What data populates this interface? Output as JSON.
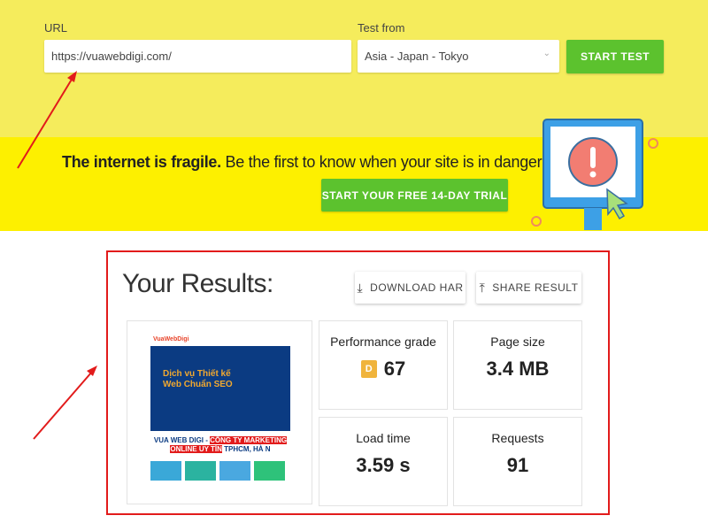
{
  "form": {
    "url_label": "URL",
    "url_value": "https://vuawebdigi.com/",
    "test_from_label": "Test from",
    "test_from_value": "Asia - Japan - Tokyo",
    "start_button": "START TEST"
  },
  "banner": {
    "bold": "The internet is fragile.",
    "text": " Be the first to know when your site is in danger.",
    "trial_button": "START YOUR FREE 14-DAY TRIAL"
  },
  "results": {
    "title": "Your Results:",
    "download_har": "DOWNLOAD HAR",
    "share_result": "SHARE RESULT",
    "performance": {
      "label": "Performance grade",
      "grade": "D",
      "value": "67"
    },
    "page_size": {
      "label": "Page size",
      "value": "3.4 MB"
    },
    "load_time": {
      "label": "Load time",
      "value": "3.59 s"
    },
    "requests": {
      "label": "Requests",
      "value": "91"
    }
  },
  "screenshot": {
    "logo": "VuaWebDigi",
    "hero": "Dịch vụ Thiết kế Web Chuẩn SEO",
    "headline_a": "VUA WEB DIGI - ",
    "headline_b": "CÔNG TY MARKETING ONLINE UY TÍN",
    "headline_c": " TPHCM, HÀ N"
  },
  "colors": {
    "accent_green": "#5cc22e",
    "annotation_red": "#e21b1b",
    "banner_yellow": "#fdf000"
  }
}
